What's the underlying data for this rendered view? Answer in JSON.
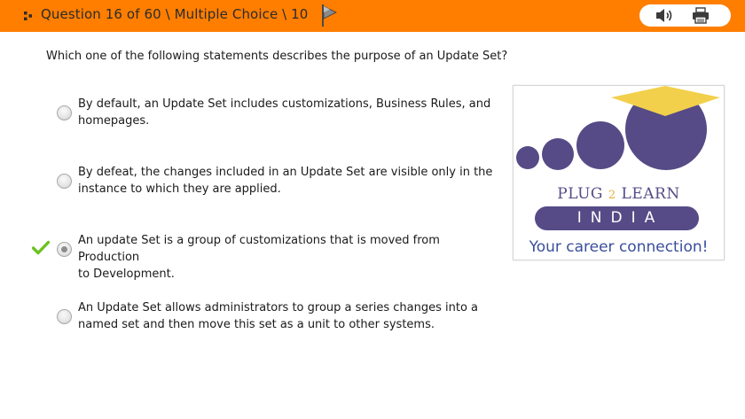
{
  "header": {
    "title": "Question 16 of 60 \\ Multiple Choice \\ 10",
    "flag_icon": "flag-icon",
    "audio_icon": "speaker-icon",
    "print_icon": "printer-icon",
    "background_color": "#ff7e00"
  },
  "question": {
    "text": "Which one of the following statements describes the purpose of an Update Set?"
  },
  "options": [
    {
      "line1": "By default, an Update Set includes customizations, Business Rules, and",
      "line2": "homepages.",
      "selected": false,
      "correct": false
    },
    {
      "line1": "By defeat, the changes included in an Update Set are visible only in the",
      "line2": "instance to which they are applied.",
      "selected": false,
      "correct": false
    },
    {
      "line1": "An update Set is a group of customizations that is moved from Production",
      "line2": "to Development.",
      "selected": true,
      "correct": true
    },
    {
      "line1": "An Update Set allows administrators to group a series changes into a",
      "line2": "named set and then move this set as a unit to other systems.",
      "selected": false,
      "correct": false
    }
  ],
  "logo": {
    "line1_a": "PLUG ",
    "line1_num": "2",
    "line1_b": " LEARN",
    "line2": "INDIA",
    "tagline": "Your career connection!",
    "primary_color": "#564b86",
    "accent_color": "#f3d04b"
  }
}
